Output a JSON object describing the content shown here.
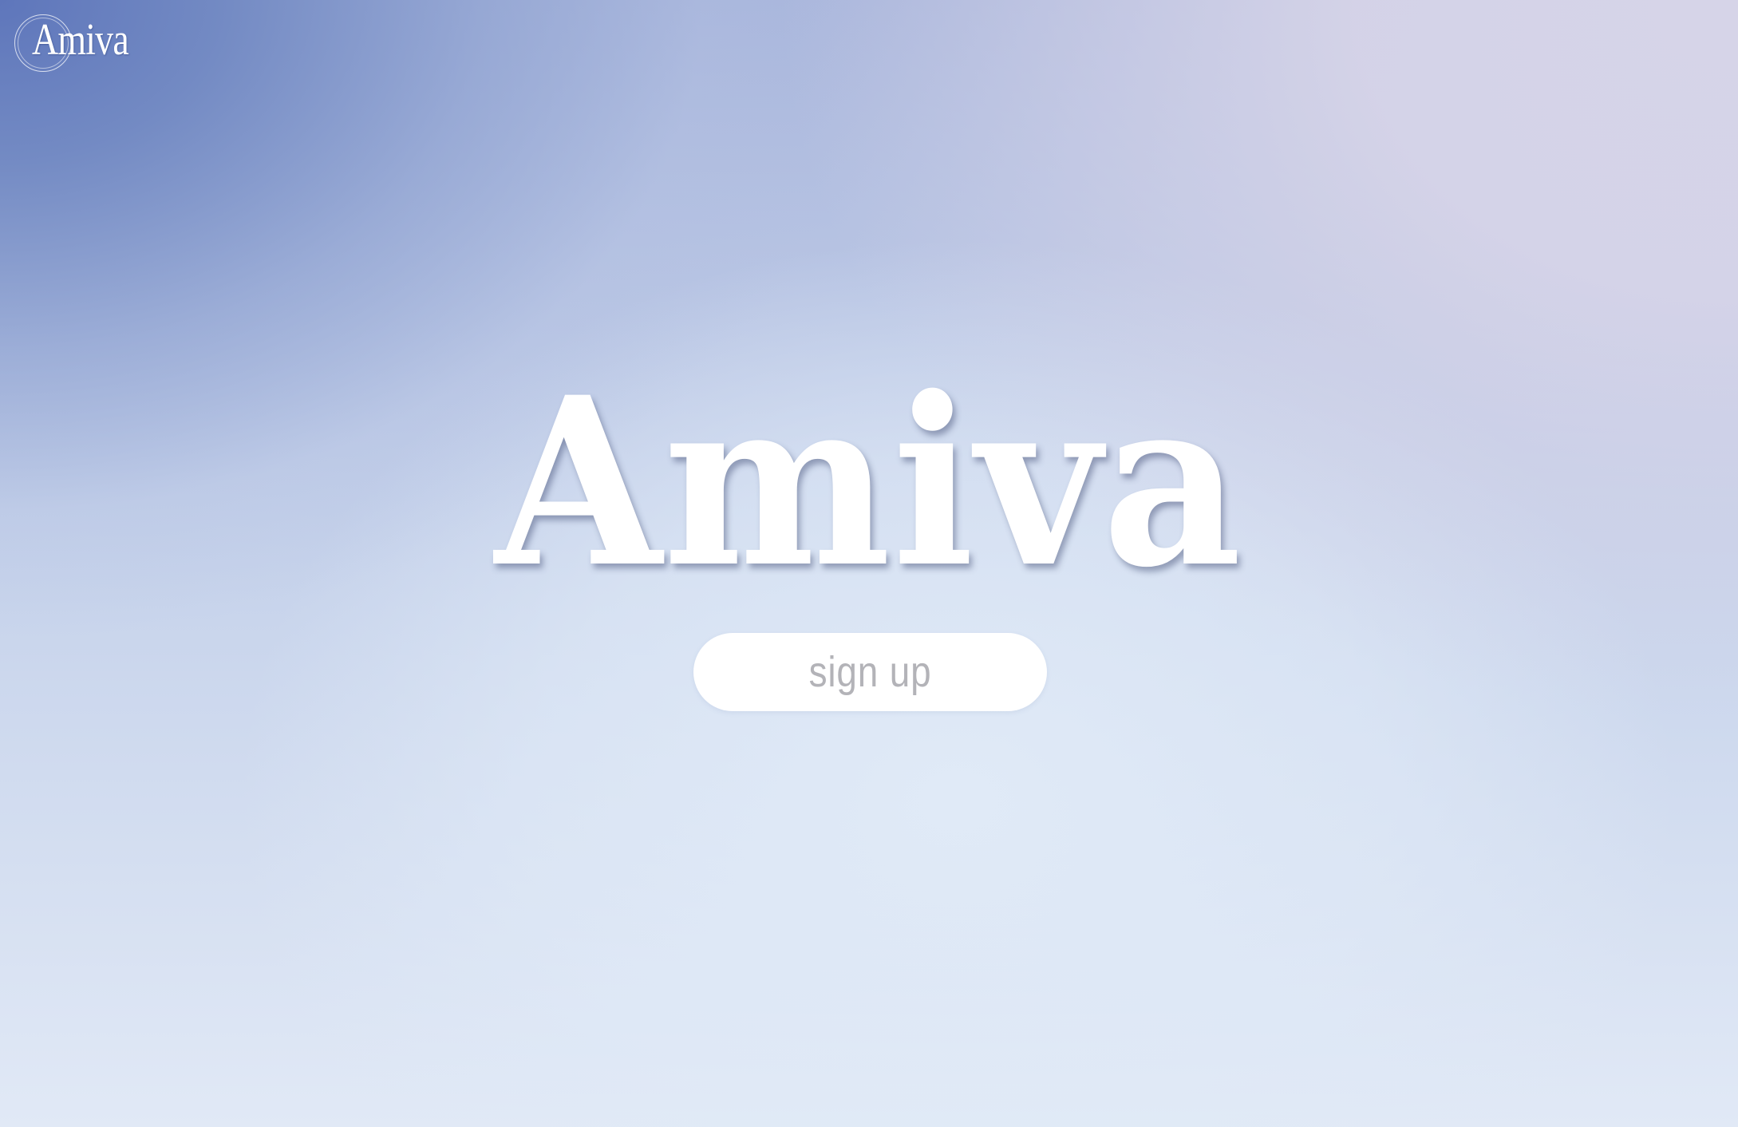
{
  "header": {
    "logo_text": "Amiva"
  },
  "hero": {
    "title": "Amiva",
    "signup_label": "sign up"
  },
  "colors": {
    "gradient_top_left": "#5e76bb",
    "gradient_top_right": "#d6d4e8",
    "gradient_bottom": "#e1e9f6",
    "title_color": "#ffffff",
    "button_bg": "#ffffff",
    "button_text": "#b3b3b8"
  }
}
